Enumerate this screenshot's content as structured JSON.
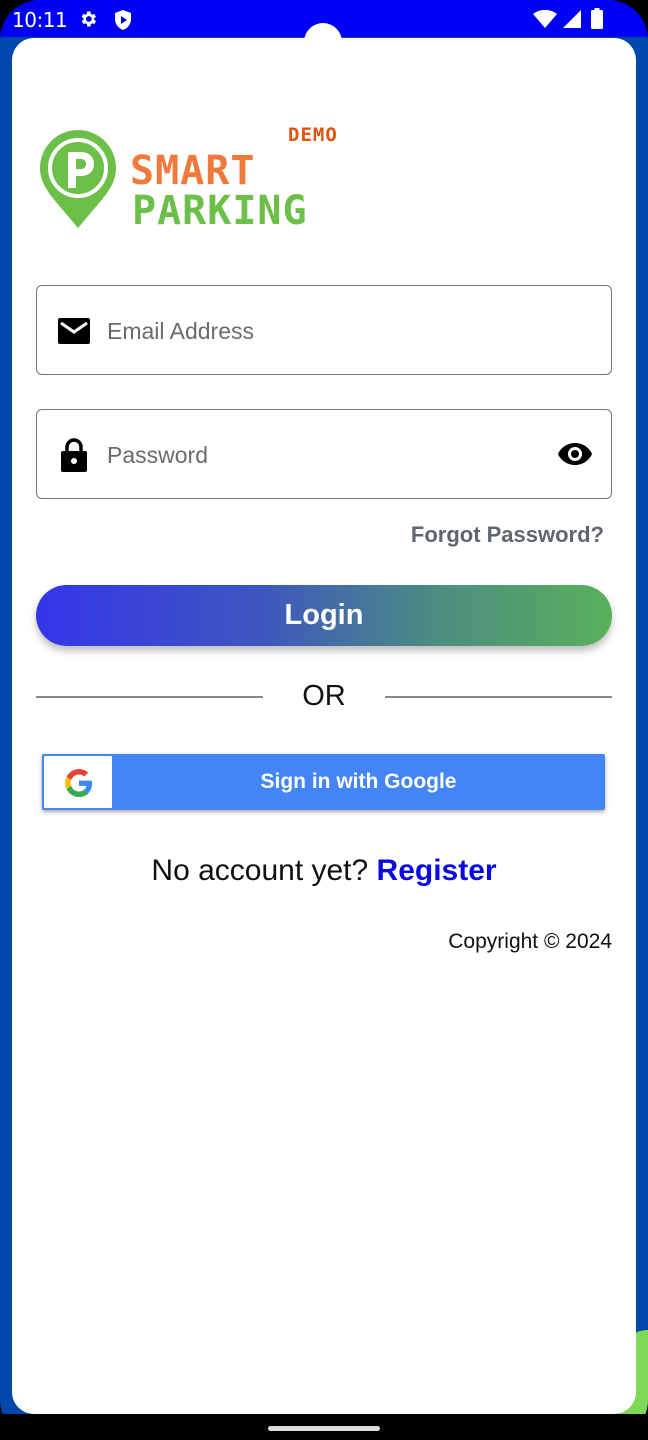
{
  "status_bar": {
    "time": "10:11",
    "left_icons": [
      "gear-icon",
      "shield-play-icon"
    ],
    "right_icons": [
      "wifi-icon",
      "signal-icon",
      "battery-icon"
    ]
  },
  "logo": {
    "badge": "DEMO",
    "line1": "SMART",
    "line2": "PARKING",
    "pin_letter": "P"
  },
  "form": {
    "email": {
      "placeholder": "Email Address",
      "value": "",
      "icon": "envelope-icon"
    },
    "password": {
      "placeholder": "Password",
      "value": "",
      "icon": "lock-icon",
      "toggle_icon": "eye-icon"
    },
    "forgot_label": "Forgot Password?",
    "login_label": "Login"
  },
  "divider": {
    "label": "OR"
  },
  "google": {
    "label": "Sign in with Google",
    "icon": "google-g-icon"
  },
  "register": {
    "prompt": "No account yet?",
    "link": "Register"
  },
  "footer": {
    "copyright": "Copyright © 2024"
  },
  "colors": {
    "status_bar": "#0000F5",
    "frame": "#0047AB",
    "brand_orange": "#F07A3C",
    "brand_green": "#6CC04A",
    "demo_red": "#E2540E",
    "google_blue": "#4385F4",
    "register_blue": "#0A0AE0"
  }
}
